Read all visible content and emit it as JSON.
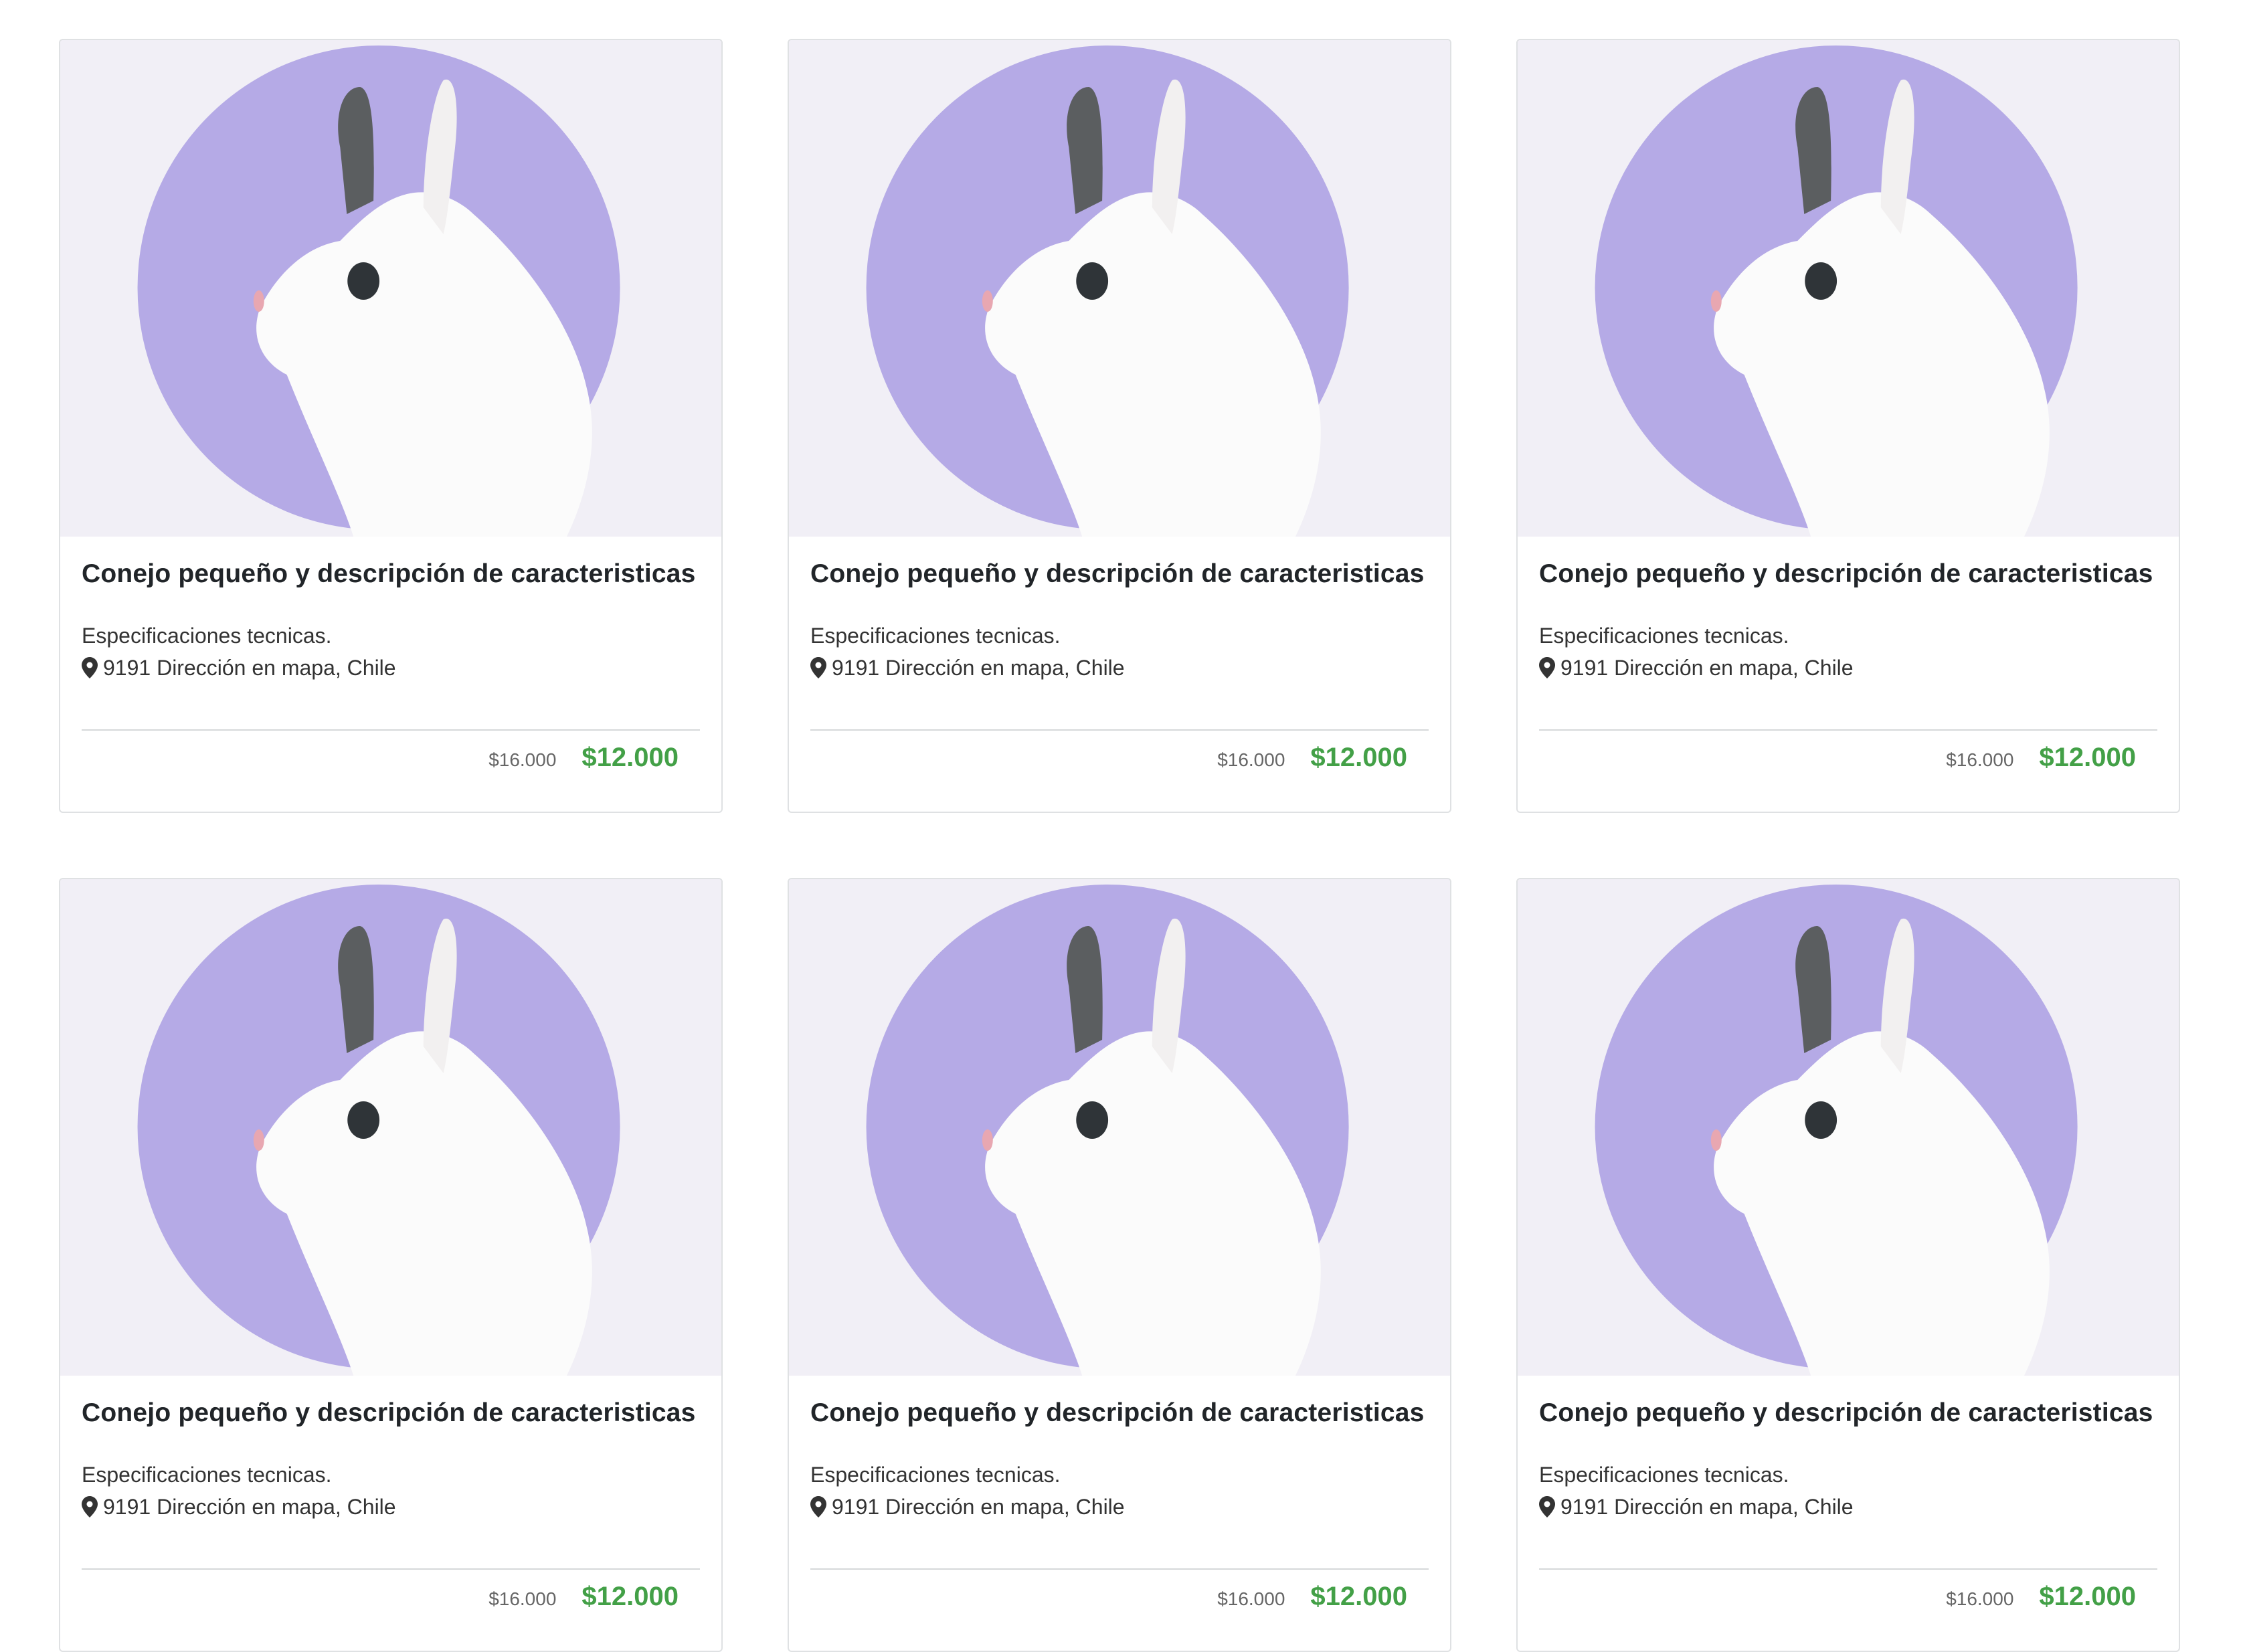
{
  "products": [
    {
      "title": "Conejo pequeño y descripción de caracteristicas",
      "specs": "Especificaciones tecnicas.",
      "address": "9191 Dirección en mapa, Chile",
      "old_price": "$16.000",
      "price": "$12.000"
    },
    {
      "title": "Conejo pequeño y descripción de caracteristicas",
      "specs": "Especificaciones tecnicas.",
      "address": "9191 Dirección en mapa, Chile",
      "old_price": "$16.000",
      "price": "$12.000"
    },
    {
      "title": "Conejo pequeño y descripción de caracteristicas",
      "specs": "Especificaciones tecnicas.",
      "address": "9191 Dirección en mapa, Chile",
      "old_price": "$16.000",
      "price": "$12.000"
    },
    {
      "title": "Conejo pequeño y descripción de caracteristicas",
      "specs": "Especificaciones tecnicas.",
      "address": "9191 Dirección en mapa, Chile",
      "old_price": "$16.000",
      "price": "$12.000"
    },
    {
      "title": "Conejo pequeño y descripción de caracteristicas",
      "specs": "Especificaciones tecnicas.",
      "address": "9191 Dirección en mapa, Chile",
      "old_price": "$16.000",
      "price": "$12.000"
    },
    {
      "title": "Conejo pequeño y descripción de caracteristicas",
      "specs": "Especificaciones tecnicas.",
      "address": "9191 Dirección en mapa, Chile",
      "old_price": "$16.000",
      "price": "$12.000"
    }
  ],
  "icons": {
    "location": "map-marker-icon"
  },
  "colors": {
    "price": "#43a047",
    "image_background": "#f1eff6",
    "image_circle": "#b5aae6"
  }
}
